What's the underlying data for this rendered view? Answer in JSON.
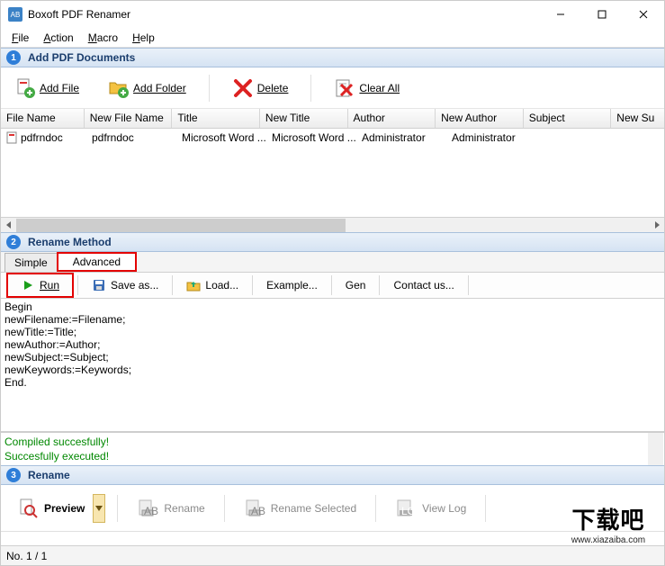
{
  "window": {
    "title": "Boxoft PDF Renamer"
  },
  "menu": {
    "file": "File",
    "action": "Action",
    "macro": "Macro",
    "help": "Help"
  },
  "section1": {
    "num": "1",
    "title": "Add PDF Documents"
  },
  "toolbar": {
    "add_file": "Add File",
    "add_folder": "Add Folder",
    "delete": "Delete",
    "clear_all": "Clear All"
  },
  "grid": {
    "columns": [
      "File Name",
      "New File Name",
      "Title",
      "New Title",
      "Author",
      "New Author",
      "Subject",
      "New Su"
    ],
    "widths": [
      95,
      100,
      100,
      100,
      100,
      100,
      100,
      60
    ],
    "row": [
      "pdfrndoc",
      "pdfrndoc",
      "Microsoft Word ...",
      "Microsoft Word ...",
      "Administrator",
      "Administrator",
      "",
      ""
    ]
  },
  "section2": {
    "num": "2",
    "title": "Rename Method"
  },
  "tabs": {
    "simple": "Simple",
    "advanced": "Advanced"
  },
  "toolbar2": {
    "run": "Run",
    "save_as": "Save as...",
    "load": "Load...",
    "example": "Example...",
    "gen": "Gen",
    "contact": "Contact us..."
  },
  "code": "Begin\nnewFilename:=Filename;\nnewTitle:=Title;\nnewAuthor:=Author;\nnewSubject:=Subject;\nnewKeywords:=Keywords;\nEnd.",
  "status": {
    "line1": "Compiled succesfully!",
    "line2": "Succesfully executed!"
  },
  "section3": {
    "num": "3",
    "title": "Rename"
  },
  "rename": {
    "preview": "Preview",
    "rename": "Rename",
    "rename_selected": "Rename Selected",
    "view_log": "View Log"
  },
  "statusbar": {
    "pos": "No. 1 / 1"
  },
  "watermark": {
    "big": "下载吧",
    "url": "www.xiazaiba.com"
  }
}
